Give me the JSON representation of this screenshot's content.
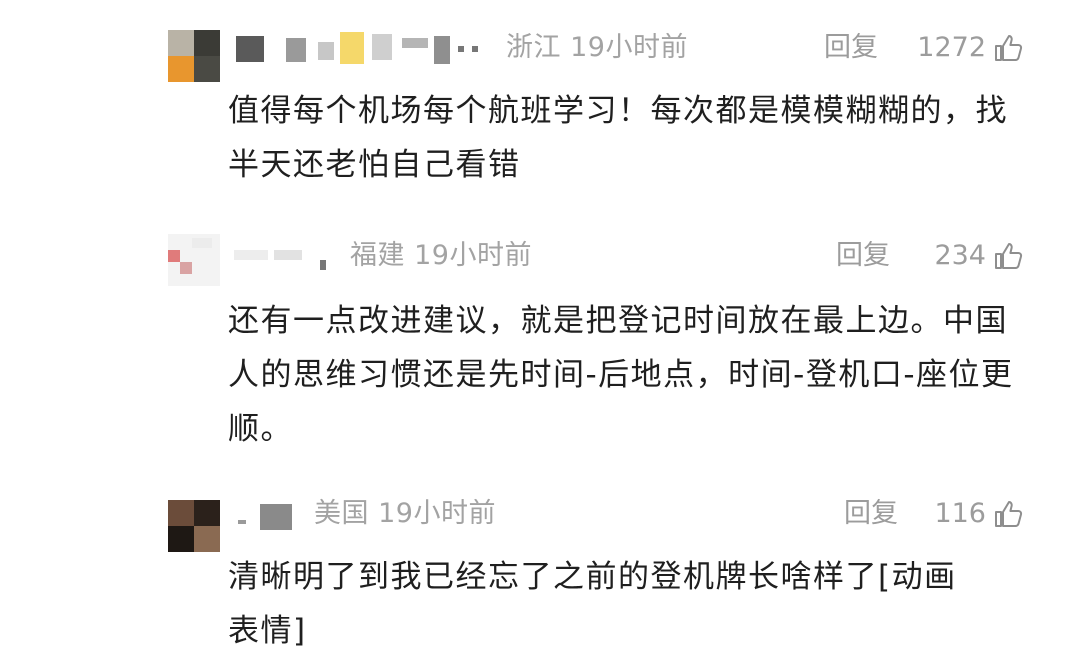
{
  "comments": [
    {
      "location": "浙江",
      "time": "19小时前",
      "reply_label": "回复",
      "likes": "1272",
      "text": "值得每个机场每个航班学习！每次都是模模糊糊的，找半天还老怕自己看错"
    },
    {
      "location": "福建",
      "time": "19小时前",
      "reply_label": "回复",
      "likes": "234",
      "text": "还有一点改进建议，就是把登记时间放在最上边。中国人的思维习惯还是先时间-后地点，时间-登机口-座位更顺。"
    },
    {
      "location": "美国",
      "time": "19小时前",
      "reply_label": "回复",
      "likes": "116",
      "text": "清晰明了到我已经忘了之前的登机牌长啥样了[动画表情]"
    }
  ],
  "icons": {
    "like": "thumbs-up-icon"
  },
  "colors": {
    "meta_text": "#a3a3a3",
    "body_text": "#1f1f1f",
    "background": "#ffffff"
  }
}
